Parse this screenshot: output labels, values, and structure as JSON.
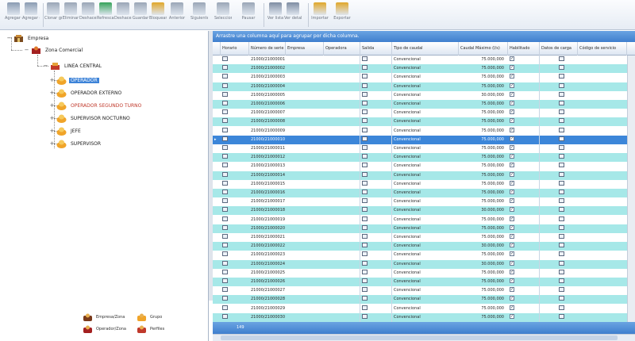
{
  "toolbar": {
    "buttons": [
      {
        "label": "Agregar grupo",
        "icon": "add-group-icon",
        "color": "#8a9bb2"
      },
      {
        "label": "Agregar operador",
        "icon": "add-operator-icon",
        "color": "#8a9bb2"
      },
      {
        "label": "Clonar grupo",
        "icon": "clone-icon",
        "color": "#9aa6b7"
      },
      {
        "label": "Eliminar",
        "icon": "delete-icon",
        "color": "#9aa6b7"
      },
      {
        "label": "Deshacer cambios",
        "icon": "undo-icon",
        "color": "#9aa6b7"
      },
      {
        "label": "Refrescar",
        "icon": "refresh-icon",
        "color": "#35a35a"
      },
      {
        "label": "Deshacer",
        "icon": "back-arrow-icon",
        "color": "#9aa6b7"
      },
      {
        "label": "Guardar",
        "icon": "save-icon",
        "color": "#9aa6b7"
      },
      {
        "label": "Bloquear",
        "icon": "lock-icon",
        "color": "#e0a72a"
      },
      {
        "label": "Anterior",
        "icon": "previous-icon",
        "color": "#9aa6b7"
      },
      {
        "label": "Siguiente",
        "icon": "next-icon",
        "color": "#9aa6b7"
      },
      {
        "label": "Seleccionar todo",
        "icon": "select-all-icon",
        "color": "#9aa6b7"
      },
      {
        "label": "Pausar",
        "icon": "pause-icon",
        "color": "#9aa6b7"
      },
      {
        "label": "Ver lista",
        "icon": "list-view-icon",
        "color": "#7f8da3"
      },
      {
        "label": "Ver detalle",
        "icon": "detail-view-icon",
        "color": "#7f8da3"
      },
      {
        "label": "Importar",
        "icon": "import-icon",
        "color": "#e0a72a"
      },
      {
        "label": "Exportar",
        "icon": "export-icon",
        "color": "#e0a72a"
      }
    ]
  },
  "tree": {
    "root": "Empresa",
    "level1": "Zona Comercial",
    "level2": "LINEA CENTRAL",
    "children": [
      {
        "label": "OPERADOR",
        "selected": true,
        "red": false
      },
      {
        "label": "OPERADOR EXTERNO",
        "selected": false,
        "red": false
      },
      {
        "label": "OPERADOR SEGUNDO TURNO",
        "selected": false,
        "red": true
      },
      {
        "label": "SUPERVISOR NOCTURNO",
        "selected": false,
        "red": false
      },
      {
        "label": "JEFE",
        "selected": false,
        "red": false
      },
      {
        "label": "SUPERVISOR",
        "selected": false,
        "red": false
      }
    ],
    "legend": [
      {
        "label": "Empresa/Zona",
        "icon": "company-legend-icon"
      },
      {
        "label": "Grupo",
        "icon": "group-legend-icon"
      },
      {
        "label": "Operador/Zona",
        "icon": "operator-legend-icon"
      },
      {
        "label": "Perfiles",
        "icon": "profiles-legend-icon"
      }
    ]
  },
  "grid": {
    "group_panel_text": "Arrastre una columna aquí para agrupar por dicha columna.",
    "columns": [
      "Horario",
      "Número de serie",
      "Empresa",
      "Operadora",
      "Salida",
      "Tipo de caudal",
      "Caudal Máximo (l/s)",
      "Habilitado",
      "Datos de carga",
      "Código de servicio"
    ],
    "rows": [
      {
        "serial": "21000/21000001",
        "type": "Convencional",
        "max": "75.000,000"
      },
      {
        "serial": "21000/21000002",
        "type": "Convencional",
        "max": "75.000,000"
      },
      {
        "serial": "21000/21000003",
        "type": "Convencional",
        "max": "75.000,000"
      },
      {
        "serial": "21000/21000004",
        "type": "Convencional",
        "max": "75.000,000"
      },
      {
        "serial": "21000/21000005",
        "type": "Convencional",
        "max": "30.000,000"
      },
      {
        "serial": "21000/21000006",
        "type": "Convencional",
        "max": "75.000,000"
      },
      {
        "serial": "21000/21000007",
        "type": "Convencional",
        "max": "75.000,000"
      },
      {
        "serial": "21000/21000008",
        "type": "Convencional",
        "max": "75.000,000"
      },
      {
        "serial": "21000/21000009",
        "type": "Convencional",
        "max": "75.000,000"
      },
      {
        "serial": "21000/21000010",
        "type": "Convencional",
        "max": "75.000,000"
      },
      {
        "serial": "21000/21000011",
        "type": "Convencional",
        "max": "75.000,000"
      },
      {
        "serial": "21000/21000012",
        "type": "Convencional",
        "max": "75.000,000"
      },
      {
        "serial": "21000/21000013",
        "type": "Convencional",
        "max": "75.000,000"
      },
      {
        "serial": "21000/21000014",
        "type": "Convencional",
        "max": "75.000,000"
      },
      {
        "serial": "21000/21000015",
        "type": "Convencional",
        "max": "75.000,000"
      },
      {
        "serial": "21000/21000016",
        "type": "Convencional",
        "max": "75.000,000"
      },
      {
        "serial": "21000/21000017",
        "type": "Convencional",
        "max": "75.000,000"
      },
      {
        "serial": "21000/21000018",
        "type": "Convencional",
        "max": "30.000,000"
      },
      {
        "serial": "21000/21000019",
        "type": "Convencional",
        "max": "75.000,000"
      },
      {
        "serial": "21000/21000020",
        "type": "Convencional",
        "max": "75.000,000"
      },
      {
        "serial": "21000/21000021",
        "type": "Convencional",
        "max": "75.000,000"
      },
      {
        "serial": "21000/21000022",
        "type": "Convencional",
        "max": "30.000,000"
      },
      {
        "serial": "21000/21000023",
        "type": "Convencional",
        "max": "75.000,000"
      },
      {
        "serial": "21000/21000024",
        "type": "Convencional",
        "max": "30.000,000"
      },
      {
        "serial": "21000/21000025",
        "type": "Convencional",
        "max": "75.000,000"
      },
      {
        "serial": "21000/21000026",
        "type": "Convencional",
        "max": "75.000,000"
      },
      {
        "serial": "21000/21000027",
        "type": "Convencional",
        "max": "75.000,000"
      },
      {
        "serial": "21000/21000028",
        "type": "Convencional",
        "max": "75.000,000"
      },
      {
        "serial": "21000/21000029",
        "type": "Convencional",
        "max": "75.000,000"
      },
      {
        "serial": "21000/21000030",
        "type": "Convencional",
        "max": "75.000,000"
      }
    ],
    "selected_row": 9,
    "footer_count": "149",
    "colors": {
      "accent": "#3f7fce",
      "alt_row": "#a6e8e8",
      "selected_row": "#3c86d9"
    }
  }
}
